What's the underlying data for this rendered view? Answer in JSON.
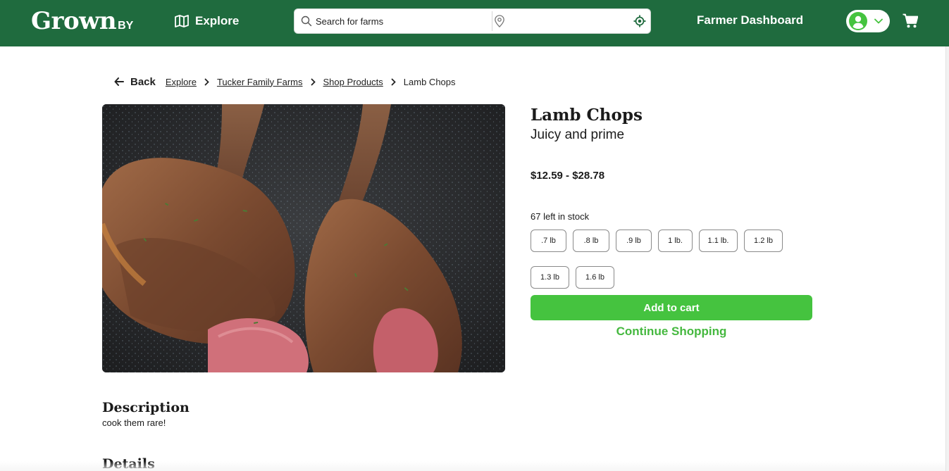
{
  "header": {
    "logo_main": "Grown",
    "logo_suffix": "BY",
    "explore_label": "Explore",
    "search_placeholder": "Search for farms",
    "location_placeholder": "",
    "farmer_dashboard_label": "Farmer Dashboard",
    "colors": {
      "bar": "#1f6b3e",
      "avatar": "#45c33f"
    }
  },
  "breadcrumb": {
    "back_label": "Back",
    "items": [
      "Explore",
      "Tucker Family Farms",
      "Shop Products"
    ],
    "current": "Lamb Chops"
  },
  "product": {
    "title": "Lamb Chops",
    "subtitle": "Juicy and prime",
    "price_range": "$12.59 - $28.78",
    "stock_text": "67 left in stock",
    "sizes": [
      ".7 lb",
      ".8 lb",
      ".9 lb",
      "1 lb.",
      "1.1 lb.",
      "1.2 lb",
      "1.3 lb",
      "1.6 lb"
    ],
    "add_to_cart_label": "Add to cart",
    "continue_label": "Continue Shopping",
    "accent_color": "#45c33f"
  },
  "description": {
    "heading": "Description",
    "text": "cook them rare!"
  },
  "details": {
    "heading": "Details"
  }
}
